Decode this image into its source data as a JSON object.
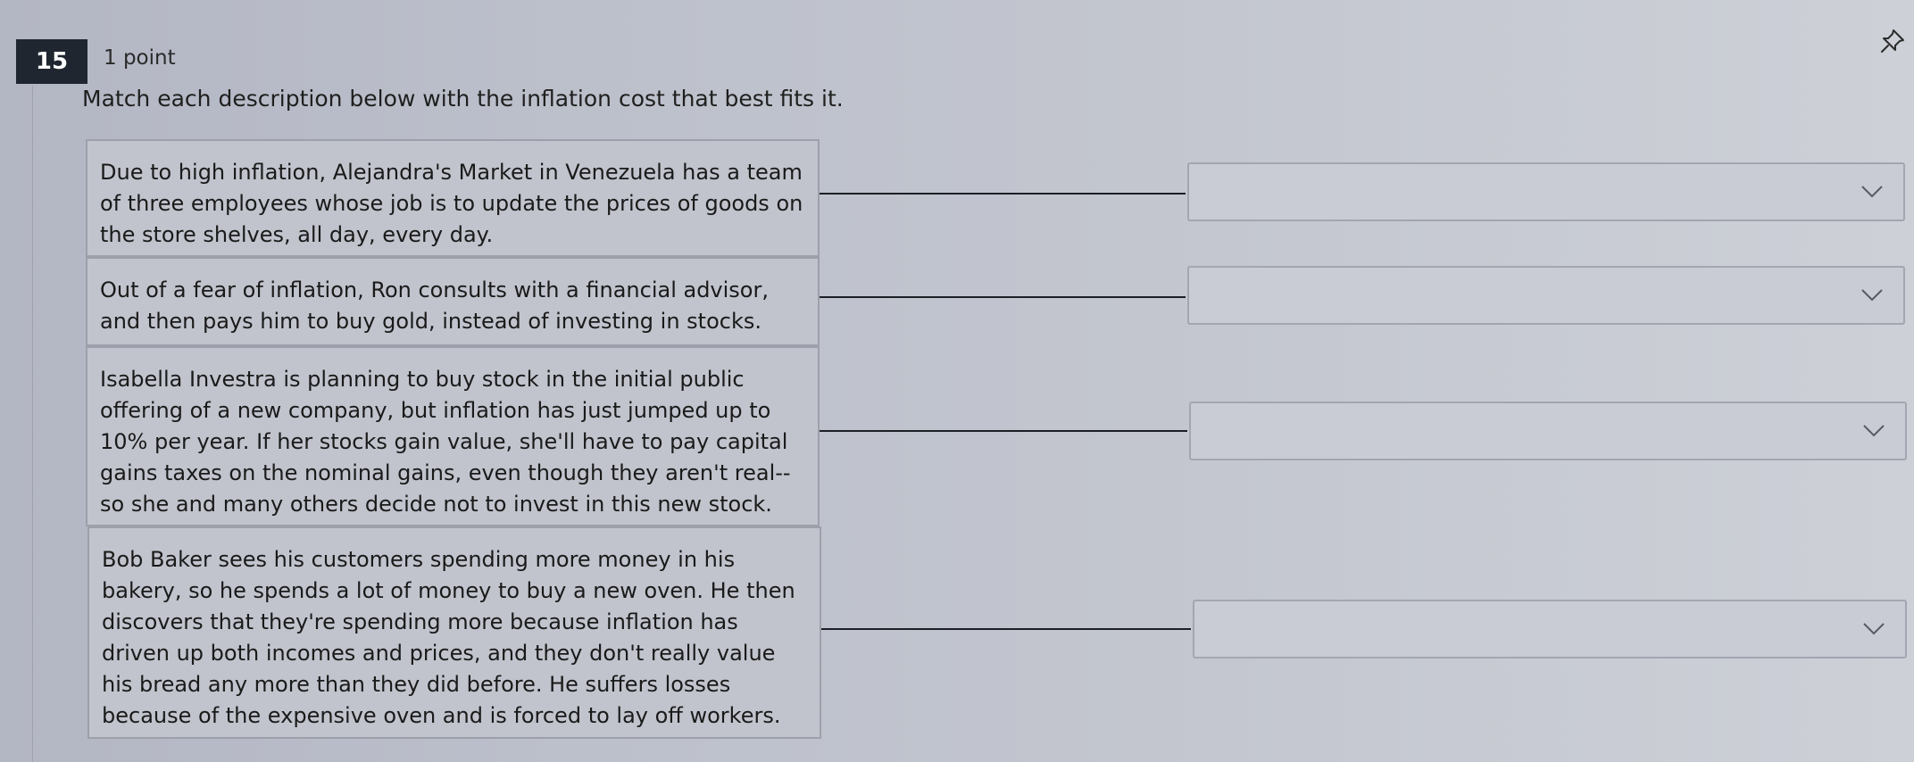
{
  "question": {
    "number": "15",
    "points": "1 point",
    "prompt": "Match each description below with the inflation cost that best fits it."
  },
  "items": [
    {
      "description": "Due to high inflation, Alejandra's Market in Venezuela has a team of three employees whose job is to update the prices of goods on the store shelves, all day, every day.",
      "selected": ""
    },
    {
      "description": "Out of a fear of inflation, Ron consults with a financial advisor, and then pays him to buy gold, instead of investing in stocks.",
      "selected": ""
    },
    {
      "description": "Isabella Investra is planning to buy stock in the initial public offering of a new company, but inflation has just jumped up to 10% per year. If her stocks gain value, she'll have to pay capital gains taxes on the nominal gains, even though they aren't real--so she and many others decide not to invest in this new stock.",
      "selected": ""
    },
    {
      "description": "Bob Baker sees his customers spending more money in his bakery, so he spends a lot of money to buy a new oven. He then discovers that they're spending more because inflation has driven up both incomes and prices, and they don't really value his bread any more than they did before. He suffers losses because of the expensive oven and is forced to lay off workers.",
      "selected": ""
    }
  ],
  "icons": {
    "pin": "pin-icon",
    "dropdown": "chevron-down-icon"
  }
}
